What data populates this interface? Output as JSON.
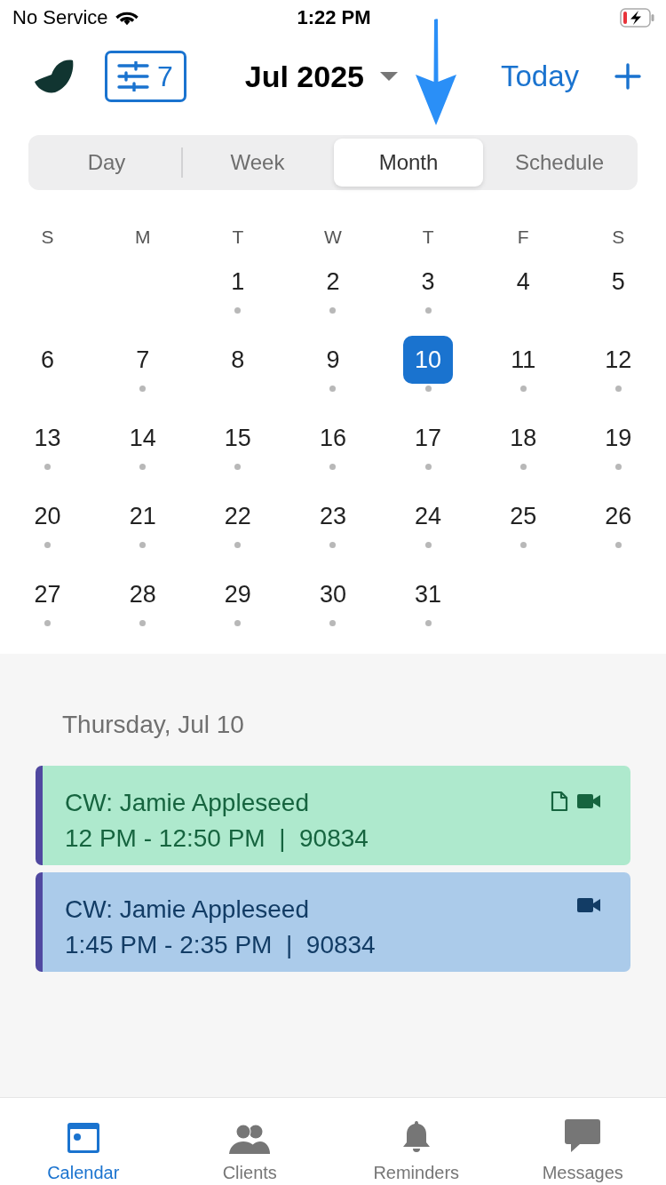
{
  "status_bar": {
    "carrier": "No Service",
    "time": "1:22 PM"
  },
  "header": {
    "filter_count": "7",
    "month": "Jul 2025",
    "today": "Today"
  },
  "view_tabs": [
    {
      "label": "Day",
      "selected": false
    },
    {
      "label": "Week",
      "selected": false
    },
    {
      "label": "Month",
      "selected": true
    },
    {
      "label": "Schedule",
      "selected": false
    }
  ],
  "weekdays": [
    "S",
    "M",
    "T",
    "W",
    "T",
    "F",
    "S"
  ],
  "weeks": [
    [
      {
        "day": "1",
        "dot": true,
        "selected": false
      },
      {
        "day": "2",
        "dot": true,
        "selected": false
      },
      {
        "day": "3",
        "dot": true,
        "selected": false
      },
      {
        "day": "4",
        "dot": false,
        "selected": false
      },
      {
        "day": "5",
        "dot": false,
        "selected": false
      }
    ],
    [
      {
        "day": "6",
        "dot": false,
        "selected": false
      },
      {
        "day": "7",
        "dot": true,
        "selected": false
      },
      {
        "day": "8",
        "dot": false,
        "selected": false
      },
      {
        "day": "9",
        "dot": true,
        "selected": false
      },
      {
        "day": "10",
        "dot": true,
        "selected": true
      },
      {
        "day": "11",
        "dot": true,
        "selected": false
      },
      {
        "day": "12",
        "dot": true,
        "selected": false
      }
    ],
    [
      {
        "day": "13",
        "dot": true,
        "selected": false
      },
      {
        "day": "14",
        "dot": true,
        "selected": false
      },
      {
        "day": "15",
        "dot": true,
        "selected": false
      },
      {
        "day": "16",
        "dot": true,
        "selected": false
      },
      {
        "day": "17",
        "dot": true,
        "selected": false
      },
      {
        "day": "18",
        "dot": true,
        "selected": false
      },
      {
        "day": "19",
        "dot": true,
        "selected": false
      }
    ],
    [
      {
        "day": "20",
        "dot": true,
        "selected": false
      },
      {
        "day": "21",
        "dot": true,
        "selected": false
      },
      {
        "day": "22",
        "dot": true,
        "selected": false
      },
      {
        "day": "23",
        "dot": true,
        "selected": false
      },
      {
        "day": "24",
        "dot": true,
        "selected": false
      },
      {
        "day": "25",
        "dot": true,
        "selected": false
      },
      {
        "day": "26",
        "dot": true,
        "selected": false
      }
    ],
    [
      {
        "day": "27",
        "dot": true,
        "selected": false
      },
      {
        "day": "28",
        "dot": true,
        "selected": false
      },
      {
        "day": "29",
        "dot": true,
        "selected": false
      },
      {
        "day": "30",
        "dot": true,
        "selected": false
      },
      {
        "day": "31",
        "dot": true,
        "selected": false
      }
    ]
  ],
  "agenda": {
    "date": "Thursday, Jul 10",
    "events": [
      {
        "title": "CW: Jamie Appleseed",
        "time": "12 PM - 12:50 PM  |  90834",
        "color": "#aee9cd",
        "icons": [
          {
            "kind": "document"
          },
          {
            "kind": "video"
          }
        ]
      },
      {
        "title": "CW: Jamie Appleseed",
        "time": "1:45 PM - 2:35 PM  |  90834",
        "color": "#abcbea",
        "icons": [
          {
            "kind": "video"
          }
        ]
      }
    ]
  },
  "tab_bar": [
    {
      "label": "Calendar",
      "kind": "calendar",
      "selected": true
    },
    {
      "label": "Clients",
      "kind": "clients",
      "selected": false
    },
    {
      "label": "Reminders",
      "kind": "reminders",
      "selected": false
    },
    {
      "label": "Messages",
      "kind": "messages",
      "selected": false
    }
  ]
}
